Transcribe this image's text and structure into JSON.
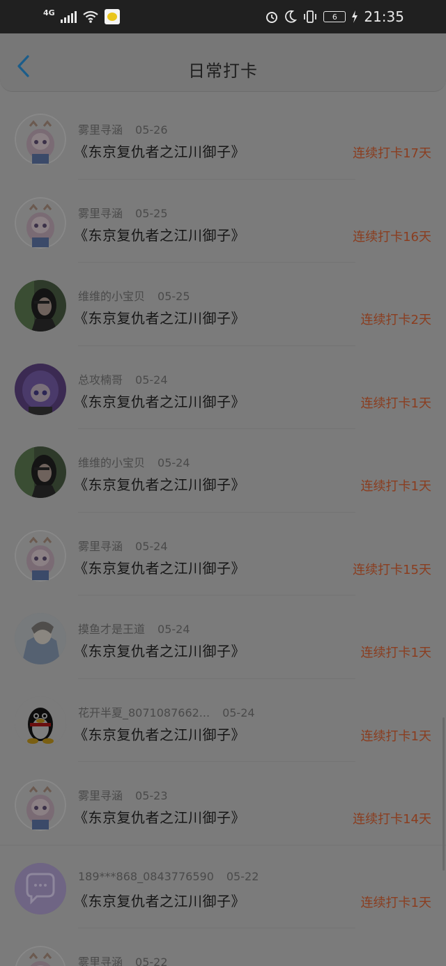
{
  "status_bar": {
    "network": "4G",
    "time": "21:35",
    "battery": "6"
  },
  "header": {
    "title": "日常打卡"
  },
  "checkins": [
    {
      "user": "雾里寻涵",
      "date": "05-26",
      "book": "《东京复仇者之江川御子》",
      "streak": "连续打卡17天",
      "avatar": "anime"
    },
    {
      "user": "雾里寻涵",
      "date": "05-25",
      "book": "《东京复仇者之江川御子》",
      "streak": "连续打卡16天",
      "avatar": "anime"
    },
    {
      "user": "维维的小宝贝",
      "date": "05-25",
      "book": "《东京复仇者之江川御子》",
      "streak": "连续打卡2天",
      "avatar": "photo-girl"
    },
    {
      "user": "总攻楠哥",
      "date": "05-24",
      "book": "《东京复仇者之江川御子》",
      "streak": "连续打卡1天",
      "avatar": "anime-purple"
    },
    {
      "user": "维维的小宝贝",
      "date": "05-24",
      "book": "《东京复仇者之江川御子》",
      "streak": "连续打卡1天",
      "avatar": "photo-girl"
    },
    {
      "user": "雾里寻涵",
      "date": "05-24",
      "book": "《东京复仇者之江川御子》",
      "streak": "连续打卡15天",
      "avatar": "anime"
    },
    {
      "user": "摸鱼才是王道",
      "date": "05-24",
      "book": "《东京复仇者之江川御子》",
      "streak": "连续打卡1天",
      "avatar": "sketch"
    },
    {
      "user": "花开半夏_8071087662...",
      "date": "05-24",
      "book": "《东京复仇者之江川御子》",
      "streak": "连续打卡1天",
      "avatar": "qq-penguin"
    },
    {
      "user": "雾里寻涵",
      "date": "05-23",
      "book": "《东京复仇者之江川御子》",
      "streak": "连续打卡14天",
      "avatar": "anime"
    },
    {
      "user": "189***868_0843776590",
      "date": "05-22",
      "book": "《东京复仇者之江川御子》",
      "streak": "连续打卡1天",
      "avatar": "default-chat"
    },
    {
      "user": "雾里寻涵",
      "date": "05-22",
      "book": "",
      "streak": "",
      "avatar": "anime"
    }
  ]
}
